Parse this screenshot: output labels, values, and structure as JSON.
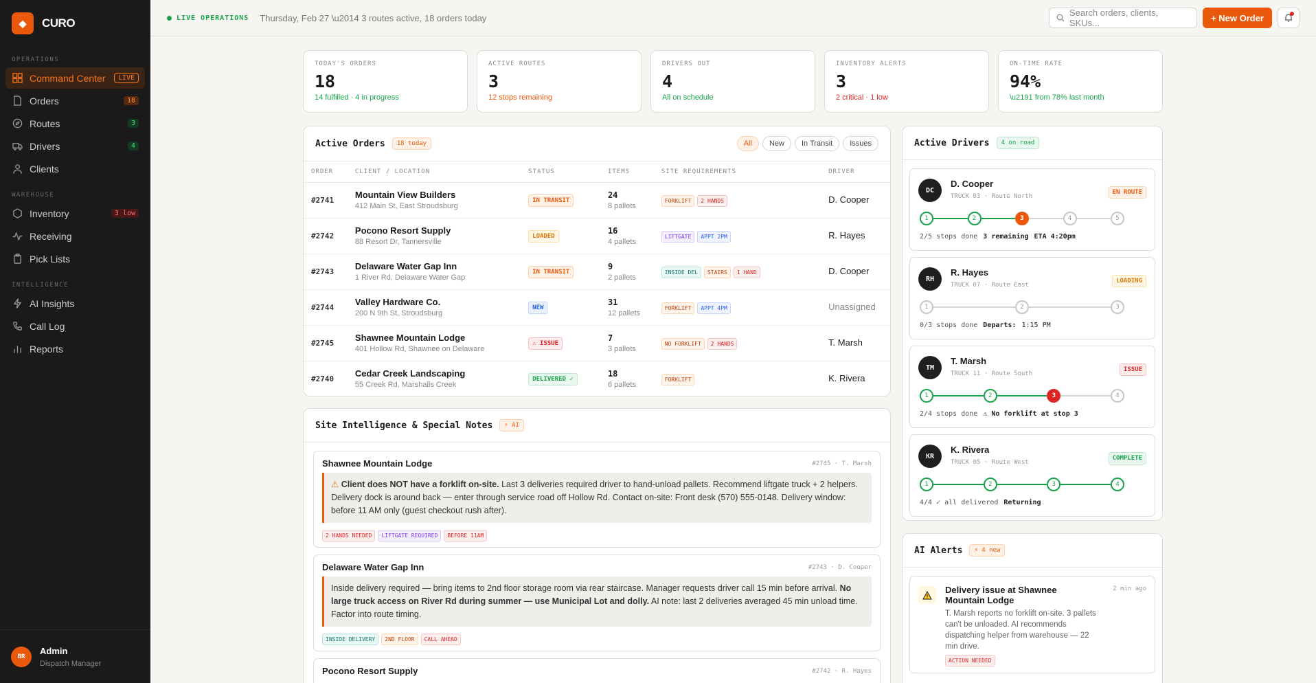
{
  "brand": {
    "name": "CURO",
    "logo_icon": "diamond-icon"
  },
  "sidebar": {
    "sections": [
      {
        "title": "OPERATIONS",
        "items": [
          {
            "label": "Command Center",
            "icon": "grid-icon",
            "badge": "LIVE",
            "active": true
          },
          {
            "label": "Orders",
            "icon": "file-icon",
            "badge": "18"
          },
          {
            "label": "Routes",
            "icon": "compass-icon",
            "badge": "3"
          },
          {
            "label": "Drivers",
            "icon": "truck-icon",
            "badge": "4"
          },
          {
            "label": "Clients",
            "icon": "user-icon",
            "badge": ""
          }
        ]
      },
      {
        "title": "WAREHOUSE",
        "items": [
          {
            "label": "Inventory",
            "icon": "hexagon-icon",
            "badge": "3 low"
          },
          {
            "label": "Receiving",
            "icon": "pulse-icon",
            "badge": ""
          },
          {
            "label": "Pick Lists",
            "icon": "clipboard-icon",
            "badge": ""
          }
        ]
      },
      {
        "title": "INTELLIGENCE",
        "items": [
          {
            "label": "AI Insights",
            "icon": "bolt-icon",
            "badge": ""
          },
          {
            "label": "Call Log",
            "icon": "phone-icon",
            "badge": ""
          },
          {
            "label": "Reports",
            "icon": "bar-chart-icon",
            "badge": ""
          }
        ]
      }
    ],
    "user": {
      "initials": "BR",
      "name": "Admin",
      "role": "Dispatch Manager"
    }
  },
  "topbar": {
    "live_label": "LIVE OPERATIONS",
    "subtitle": "Thursday, Feb 27 \\u2014 3 routes active, 18 orders today",
    "search_placeholder": "Search orders, clients, SKUs...",
    "new_order_label": "+ New Order"
  },
  "kpis": [
    {
      "label": "TODAY'S ORDERS",
      "value": "18",
      "sub": "14 fulfilled · 4 in progress",
      "tone": "green"
    },
    {
      "label": "ACTIVE ROUTES",
      "value": "3",
      "sub": "12 stops remaining",
      "tone": "orange"
    },
    {
      "label": "DRIVERS OUT",
      "value": "4",
      "sub": "All on schedule",
      "tone": "green"
    },
    {
      "label": "INVENTORY ALERTS",
      "value": "3",
      "sub": "2 critical · 1 low",
      "tone": "red"
    },
    {
      "label": "ON-TIME RATE",
      "value": "94%",
      "sub": "\\u2191 from 78% last month",
      "tone": "green"
    }
  ],
  "orders": {
    "title": "Active Orders",
    "badge": "18 today",
    "filters": [
      "All",
      "New",
      "In Transit",
      "Issues"
    ],
    "columns": [
      "ORDER",
      "CLIENT / LOCATION",
      "STATUS",
      "ITEMS",
      "SITE REQUIREMENTS",
      "DRIVER"
    ],
    "rows": [
      {
        "id": "#2741",
        "client": "Mountain View Builders",
        "address": "412 Main St, East Stroudsburg",
        "status": "IN TRANSIT",
        "status_class": "st-transit",
        "items": "24",
        "pallets": "8 pallets",
        "tags": [
          {
            "t": "FORKLIFT",
            "c": "t-o"
          },
          {
            "t": "2 HANDS",
            "c": "t-r"
          }
        ],
        "driver": "D. Cooper"
      },
      {
        "id": "#2742",
        "client": "Pocono Resort Supply",
        "address": "88 Resort Dr, Tannersville",
        "status": "LOADED",
        "status_class": "st-loaded",
        "items": "16",
        "pallets": "4 pallets",
        "tags": [
          {
            "t": "LIFTGATE",
            "c": "t-p"
          },
          {
            "t": "APPT 2PM",
            "c": "t-b"
          }
        ],
        "driver": "R. Hayes"
      },
      {
        "id": "#2743",
        "client": "Delaware Water Gap Inn",
        "address": "1 River Rd, Delaware Water Gap",
        "status": "IN TRANSIT",
        "status_class": "st-transit",
        "items": "9",
        "pallets": "2 pallets",
        "tags": [
          {
            "t": "INSIDE DEL",
            "c": "t-t"
          },
          {
            "t": "STAIRS",
            "c": "t-o"
          },
          {
            "t": "1 HAND",
            "c": "t-r"
          }
        ],
        "driver": "D. Cooper"
      },
      {
        "id": "#2744",
        "client": "Valley Hardware Co.",
        "address": "200 N 9th St, Stroudsburg",
        "status": "NEW",
        "status_class": "st-new",
        "items": "31",
        "pallets": "12 pallets",
        "tags": [
          {
            "t": "FORKLIFT",
            "c": "t-o"
          },
          {
            "t": "APPT 4PM",
            "c": "t-b"
          }
        ],
        "driver": "Unassigned"
      },
      {
        "id": "#2745",
        "client": "Shawnee Mountain Lodge",
        "address": "401 Hollow Rd, Shawnee on Delaware",
        "status": "⚠ ISSUE",
        "status_class": "st-issue",
        "items": "7",
        "pallets": "3 pallets",
        "tags": [
          {
            "t": "NO FORKLIFT",
            "c": "t-o"
          },
          {
            "t": "2 HANDS",
            "c": "t-r"
          }
        ],
        "driver": "T. Marsh"
      },
      {
        "id": "#2740",
        "client": "Cedar Creek Landscaping",
        "address": "55 Creek Rd, Marshalls Creek",
        "status": "DELIVERED ✓",
        "status_class": "st-delivered",
        "items": "18",
        "pallets": "6 pallets",
        "tags": [
          {
            "t": "FORKLIFT",
            "c": "t-o"
          }
        ],
        "driver": "K. Rivera"
      }
    ]
  },
  "site_intel": {
    "title": "Site Intelligence & Special Notes",
    "badge": "AI",
    "notes": [
      {
        "title": "Shawnee Mountain Lodge",
        "meta": "#2745 · T. Marsh",
        "body_bold": "Client does NOT have a forklift on-site.",
        "body": " Last 3 deliveries required driver to hand-unload pallets. Recommend liftgate truck + 2 helpers. Delivery dock is around back — enter through service road off Hollow Rd. Contact on-site: Front desk (570) 555-0148. Delivery window: before 11 AM only (guest checkout rush after).",
        "tags": [
          {
            "t": "2 HANDS NEEDED",
            "c": "t-r"
          },
          {
            "t": "LIFTGATE REQUIRED",
            "c": "t-p"
          },
          {
            "t": "BEFORE 11AM",
            "c": "t-r"
          }
        ]
      },
      {
        "title": "Delaware Water Gap Inn",
        "meta": "#2743 · D. Cooper",
        "body_pre": "Inside delivery required — bring items to 2nd floor storage room via rear staircase. Manager requests driver call 15 min before arrival. ",
        "body_bold": "No large truck access on River Rd during summer — use Municipal Lot and dolly.",
        "body": " AI note: last 2 deliveries averaged 45 min unload time. Factor into route timing.",
        "tags": [
          {
            "t": "INSIDE DELIVERY",
            "c": "t-t"
          },
          {
            "t": "2ND FLOOR",
            "c": "t-o"
          },
          {
            "t": "CALL AHEAD",
            "c": "t-r"
          }
        ]
      },
      {
        "title": "Pocono Resort Supply",
        "meta": "#2742 · R. Hayes"
      }
    ]
  },
  "drivers": {
    "title": "Active Drivers",
    "badge": "4 on road",
    "list": [
      {
        "initials": "DC",
        "name": "D. Cooper",
        "truck": "TRUCK 03 · Route North",
        "status": "EN ROUTE",
        "status_class": "st-transit",
        "stops": 5,
        "done": 2,
        "current": 3,
        "bad": 0,
        "foot": "2/5 stops done",
        "foot_b": "3 remaining",
        "foot_c": "ETA 4:20pm"
      },
      {
        "initials": "RH",
        "name": "R. Hayes",
        "truck": "TRUCK 07 · Route East",
        "status": "LOADING",
        "status_class": "st-loaded",
        "stops": 3,
        "done": 0,
        "current": 0,
        "bad": 0,
        "foot": "0/3 stops done",
        "foot_b": "Departs:",
        "foot_c": "1:15 PM"
      },
      {
        "initials": "TM",
        "name": "T. Marsh",
        "truck": "TRUCK 11 · Route South",
        "status": "ISSUE",
        "status_class": "st-issue",
        "stops": 4,
        "done": 2,
        "current": 0,
        "bad": 3,
        "foot": "2/4 stops done",
        "foot_b": "⚠ No forklift at stop 3",
        "foot_c": ""
      },
      {
        "initials": "KR",
        "name": "K. Rivera",
        "truck": "TRUCK 05 · Route West",
        "status": "COMPLETE",
        "status_class": "st-delivered",
        "stops": 4,
        "done": 4,
        "current": 0,
        "bad": 0,
        "foot": "4/4 ✓ all delivered",
        "foot_b": "Returning",
        "foot_c": ""
      }
    ]
  },
  "ai_alerts": {
    "title": "AI Alerts",
    "badge": "⚡ 4 new",
    "items": [
      {
        "title": "Delivery issue at Shawnee Mountain Lodge",
        "time": "2 min ago",
        "body": "T. Marsh reports no forklift on-site. 3 pallets can't be unloaded. AI recommends dispatching helper from warehouse — 22 min drive.",
        "tag": "ACTION NEEDED"
      }
    ]
  }
}
